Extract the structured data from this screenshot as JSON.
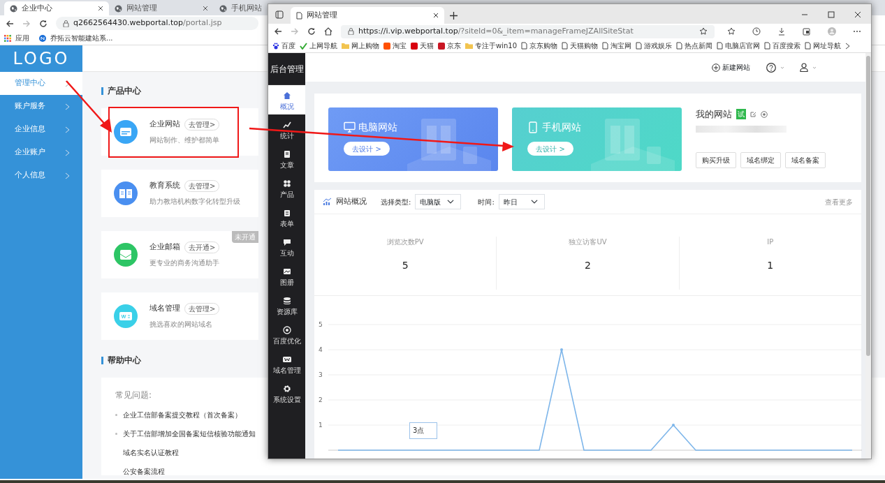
{
  "back_window": {
    "tabs": [
      {
        "title": "企业中心",
        "selected": true
      },
      {
        "title": "网站管理",
        "selected": false
      },
      {
        "title": "手机网站",
        "selected": false
      }
    ],
    "address": {
      "host": "q2662564430.webportal.top",
      "path": "/portal.jsp"
    },
    "bookmarks": [
      {
        "label": "应用",
        "kind": "apps"
      },
      {
        "label": "乔拓云智能建站系...",
        "kind": "site"
      }
    ],
    "logo": "LOGO",
    "sidebar": [
      {
        "label": "管理中心",
        "selected": true
      },
      {
        "label": "账户服务",
        "selected": false
      },
      {
        "label": "企业信息",
        "selected": false
      },
      {
        "label": "企业账户",
        "selected": false
      },
      {
        "label": "个人信息",
        "selected": false
      }
    ],
    "product_section": {
      "title": "产品中心",
      "products": [
        {
          "name": "企业网站",
          "action": "去管理>",
          "desc": "网站制作、维护都简单",
          "kind": "website"
        },
        {
          "name": "教育系统",
          "action": "去管理>",
          "desc": "助力教培机构数字化转型升级",
          "kind": "education"
        },
        {
          "name": "企业邮箱",
          "action": "去开通>",
          "desc": "更专业的商务沟通助手",
          "kind": "mail",
          "badge": "未开通"
        },
        {
          "name": "域名管理",
          "action": "去管理>",
          "desc": "挑选喜欢的网站域名",
          "kind": "domain"
        }
      ]
    },
    "help_section": {
      "title": "帮助中心",
      "faq_label": "常见问题:",
      "items": [
        {
          "text": "企业工信部备案提交教程（首次备案）",
          "bullet": true
        },
        {
          "text": "关于工信部增加全国备案短信核验功能通知",
          "bullet": true
        },
        {
          "text": "域名实名认证教程",
          "bullet": false
        },
        {
          "text": "公安备案流程",
          "bullet": false
        }
      ]
    }
  },
  "front_window": {
    "tabs": [
      {
        "title": "网站管理",
        "selected": true
      }
    ],
    "address": {
      "host": "https://i.vip.webportal.top",
      "path": "/?siteId=0&_item=manageFrameJZAllSiteStat"
    },
    "bookmarks": [
      {
        "label": "百度",
        "kind": "paw"
      },
      {
        "label": "上网导航",
        "kind": "check"
      },
      {
        "label": "网上购物",
        "kind": "folder"
      },
      {
        "label": "淘宝",
        "kind": "site",
        "color": "#ff5000"
      },
      {
        "label": "天猫",
        "kind": "site",
        "color": "#d8000f"
      },
      {
        "label": "京东",
        "kind": "site",
        "color": "#c91623"
      },
      {
        "label": "专注于win10",
        "kind": "folder"
      },
      {
        "label": "京东购物",
        "kind": "page"
      },
      {
        "label": "天猫购物",
        "kind": "page"
      },
      {
        "label": "淘宝网",
        "kind": "page"
      },
      {
        "label": "游戏娱乐",
        "kind": "page"
      },
      {
        "label": "热点新闻",
        "kind": "page"
      },
      {
        "label": "电脑店官网",
        "kind": "page"
      },
      {
        "label": "百度搜索",
        "kind": "page"
      },
      {
        "label": "网址导航",
        "kind": "page"
      }
    ],
    "admin": {
      "brand": "后台管理",
      "nav": [
        {
          "label": "概况",
          "kind": "home",
          "selected": true
        },
        {
          "label": "统计",
          "kind": "stats",
          "selected": false
        },
        {
          "label": "文章",
          "kind": "doc",
          "selected": false
        },
        {
          "label": "产品",
          "kind": "grid",
          "selected": false
        },
        {
          "label": "表单",
          "kind": "form",
          "selected": false
        },
        {
          "label": "互动",
          "kind": "chat",
          "selected": false
        },
        {
          "label": "图册",
          "kind": "album",
          "selected": false
        },
        {
          "label": "资源库",
          "kind": "db",
          "selected": false
        },
        {
          "label": "百度优化",
          "kind": "target",
          "selected": false
        },
        {
          "label": "域名管理",
          "kind": "w",
          "selected": false
        },
        {
          "label": "系统设置",
          "kind": "gear",
          "selected": false
        }
      ],
      "header": {
        "new_site": "新建网站"
      },
      "site_cards": [
        {
          "title": "电脑网站",
          "action": "去设计 >",
          "kind": "pc"
        },
        {
          "title": "手机网站",
          "action": "去设计 >",
          "kind": "mobile"
        }
      ],
      "my_site": {
        "title": "我的网站",
        "badge": "试",
        "buttons": [
          "购买升级",
          "域名绑定",
          "域名备案"
        ]
      },
      "overview": {
        "title": "网站概况",
        "type_label": "选择类型:",
        "type_value": "电脑版",
        "time_label": "时间:",
        "time_value": "昨日",
        "more": "查看更多",
        "stats": [
          {
            "label": "浏览次数PV",
            "value": "5"
          },
          {
            "label": "独立访客UV",
            "value": "2"
          },
          {
            "label": "IP",
            "value": "1"
          }
        ],
        "tooltip": {
          "title": "3点"
        },
        "chart_data": {
          "type": "line",
          "ylim": [
            0,
            5
          ],
          "grid": true,
          "yticks": [
            1,
            2,
            3,
            4,
            5
          ],
          "series": [
            {
              "color": "#7eb6ea",
              "values": [
                0,
                0,
                0,
                0,
                0,
                0,
                0,
                0,
                0,
                0,
                4,
                0,
                0,
                0,
                0,
                1,
                0,
                0,
                0,
                0,
                0,
                0,
                0,
                0
              ]
            }
          ]
        }
      }
    }
  }
}
